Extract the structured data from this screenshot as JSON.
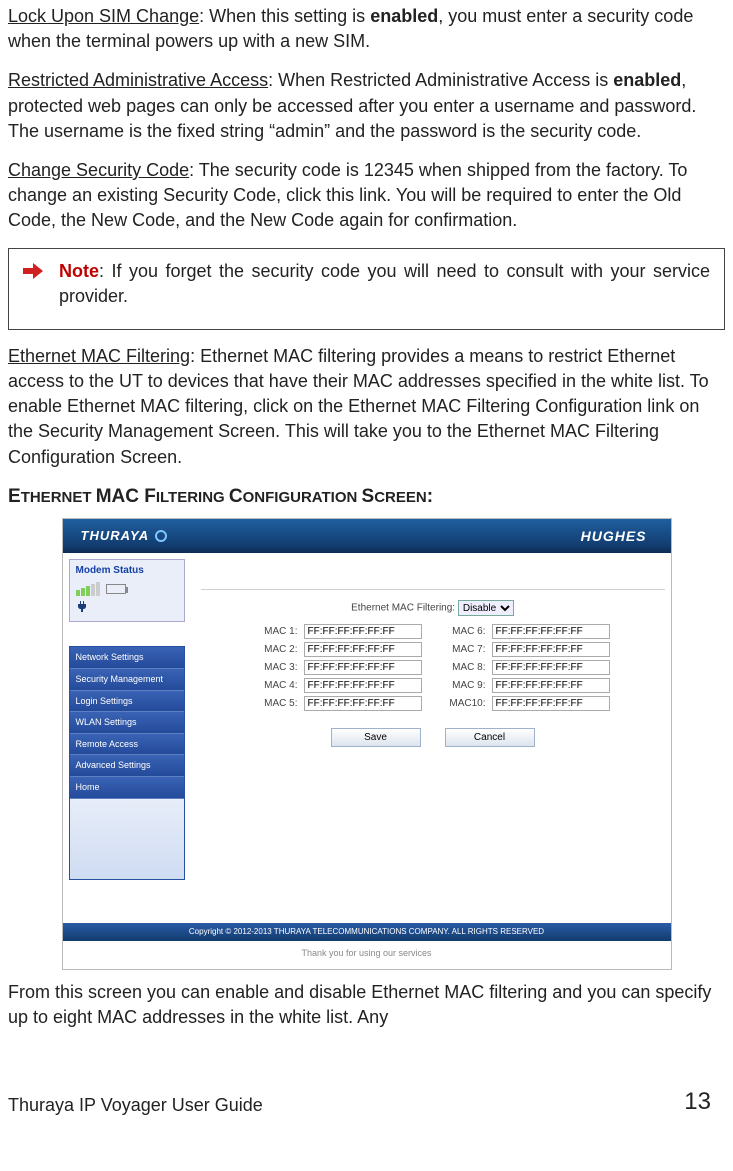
{
  "paragraphs": {
    "lock_title": "Lock Upon SIM Change",
    "lock_body_pre": ":  When this setting is ",
    "lock_enabled": "enabled",
    "lock_body_post": ", you must enter a security code when the terminal powers up with a new SIM.",
    "raa_title": "Restricted Administrative Access",
    "raa_body_pre": ":  When Restricted Administrative Access is ",
    "raa_enabled": "enabled",
    "raa_body_post": ", protected web pages can only be accessed after you enter a username and password. The username is the fixed string “admin” and the password is the security code.",
    "csc_title": "Change Security Code",
    "csc_body": ": The security code is 12345 when shipped from the factory. To change an existing Security Code, click this link. You will be required to enter the Old Code, the New Code, and the New Code again for confirmation.",
    "note_label": "Note",
    "note_body": ": If you forget the security code you will need to consult with your service provider.",
    "emf_title": "Ethernet MAC Filtering",
    "emf_body": ": Ethernet MAC filtering provides a means to restrict Ethernet access to the UT to devices that have their MAC addresses specified in the white list. To enable Ethernet MAC filtering, click on the Ethernet MAC Filtering Configuration link on the Security Management Screen. This will take you to the Ethernet MAC Filtering Configuration Screen."
  },
  "heading_screen": "ETHERNET MAC FILTERING CONFIGURATION SCREEN:",
  "screenshot": {
    "brand_left": "THURAYA",
    "brand_right": "HUGHES",
    "modem_status": "Modem Status",
    "nav_items": [
      "Network Settings",
      "Security Management",
      "Login Settings",
      "WLAN Settings",
      "Remote Access",
      "Advanced Settings",
      "Home"
    ],
    "filter_label": "Ethernet MAC Filtering:",
    "filter_value": "Disable",
    "mac_labels_left": [
      "MAC 1:",
      "MAC 2:",
      "MAC 3:",
      "MAC 4:",
      "MAC 5:"
    ],
    "mac_labels_right": [
      "MAC 6:",
      "MAC 7:",
      "MAC 8:",
      "MAC 9:",
      "MAC10:"
    ],
    "mac_default": "FF:FF:FF:FF:FF:FF",
    "save_btn": "Save",
    "cancel_btn": "Cancel",
    "copyright": "Copyright © 2012-2013 THURAYA TELECOMMUNICATIONS COMPANY. ALL RIGHTS RESERVED",
    "thanks": "Thank you for using our services"
  },
  "post_text": "From this screen you can enable and disable Ethernet MAC filtering and you can specify up to eight MAC addresses in the white list. Any",
  "footer": {
    "title_a": "Thuraya IP Voyager ",
    "title_b": "User Guide",
    "page": "13"
  }
}
